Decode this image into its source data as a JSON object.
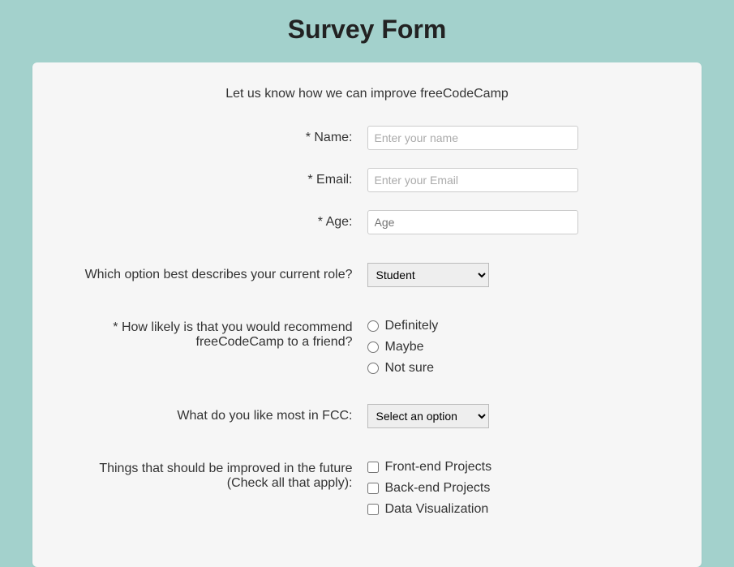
{
  "title": "Survey Form",
  "intro": "Let us know how we can improve freeCodeCamp",
  "fields": {
    "name": {
      "label": "* Name:",
      "placeholder": "Enter your name"
    },
    "email": {
      "label": "* Email:",
      "placeholder": "Enter your Email"
    },
    "age": {
      "label": "* Age:",
      "placeholder": "Age"
    },
    "role": {
      "label": "Which option best describes your current role?",
      "selected": "Student"
    },
    "recommend": {
      "label": "* How likely is that you would recommend freeCodeCamp to a friend?",
      "options": {
        "0": "Definitely",
        "1": "Maybe",
        "2": "Not sure"
      }
    },
    "like": {
      "label": "What do you like most in FCC:",
      "selected": "Select an option"
    },
    "improve": {
      "label": "Things that should be improved in the future (Check all that apply):",
      "options": {
        "0": "Front-end Projects",
        "1": "Back-end Projects",
        "2": "Data Visualization"
      }
    }
  }
}
